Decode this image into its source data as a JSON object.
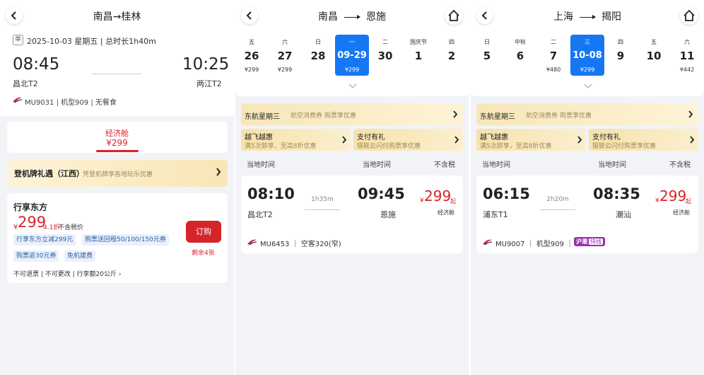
{
  "panel1": {
    "title": "南昌→桂林",
    "tag": "单",
    "date_line": "2025-10-03 星期五 | 总时长1h40m",
    "dep_time": "08:45",
    "arr_time": "10:25",
    "dep_terminal": "昌北T2",
    "arr_terminal": "两江T2",
    "flight_info": "MU9031 | 机型909 | 无餐食",
    "cabin_name": "经济舱",
    "cabin_price": "¥299",
    "board_title": "登机牌礼遇（江西）",
    "board_sub": "凭登机牌享各地玩乐优惠",
    "product": {
      "name": "行享东方",
      "currency": "¥",
      "price": "299",
      "discount": "4.1折",
      "tax_note": "不含税价",
      "chips": [
        "行享东方立减299元",
        "购票送回程50/100/150元券",
        "购票返30元券",
        "免机建费"
      ],
      "rules": "不可退票 | 不可更改 | 行李额20公斤 ›",
      "buy_label": "订购",
      "remaining": "剩余4张"
    }
  },
  "panel2": {
    "origin": "南昌",
    "dest": "恩施",
    "dates": [
      {
        "wd": "五",
        "d": "26",
        "p": "¥299"
      },
      {
        "wd": "六",
        "d": "27",
        "p": "¥299"
      },
      {
        "wd": "日",
        "d": "28",
        "p": ""
      },
      {
        "wd": "一",
        "d": "09-29",
        "p": "¥299"
      },
      {
        "wd": "二",
        "d": "30",
        "p": ""
      },
      {
        "wd": "国庆节",
        "d": "1",
        "p": ""
      },
      {
        "wd": "四",
        "d": "2",
        "p": ""
      }
    ],
    "promo_title": "东航星期三",
    "promo_sub": "航空消费券 购票享优惠",
    "promo_a_title": "越飞越惠",
    "promo_a_sub": "满5次即享，至高8折优惠",
    "promo_b_title": "支付有礼",
    "promo_b_sub": "银联云闪付购票享优惠",
    "col_dep": "当地时间",
    "col_arr": "当地时间",
    "col_tax": "不含税",
    "flight": {
      "dep_time": "08:10",
      "arr_time": "09:45",
      "duration": "1h35m",
      "dep_terminal": "昌北T2",
      "arr_terminal": "恩施",
      "currency": "¥",
      "price": "299",
      "qi": "起",
      "cabin": "经济舱",
      "meta": "MU6453 ｜ 空客320(窄)"
    }
  },
  "panel3": {
    "origin": "上海",
    "dest": "揭阳",
    "dates": [
      {
        "wd": "日",
        "d": "5",
        "p": ""
      },
      {
        "wd": "中秋",
        "d": "6",
        "p": ""
      },
      {
        "wd": "二",
        "d": "7",
        "p": "¥480"
      },
      {
        "wd": "三",
        "d": "10-08",
        "p": "¥299"
      },
      {
        "wd": "四",
        "d": "9",
        "p": ""
      },
      {
        "wd": "五",
        "d": "10",
        "p": ""
      },
      {
        "wd": "六",
        "d": "11",
        "p": "¥442"
      }
    ],
    "promo_title": "东航星期三",
    "promo_sub": "航空消费券 购票享优惠",
    "promo_a_title": "越飞越惠",
    "promo_a_sub": "满5次即享，至高8折优惠",
    "promo_b_title": "支付有礼",
    "promo_b_sub": "银联云闪付购票享优惠",
    "col_dep": "当地时间",
    "col_arr": "当地时间",
    "col_tax": "不含税",
    "flight": {
      "dep_time": "06:15",
      "arr_time": "08:35",
      "duration": "2h20m",
      "dep_terminal": "浦东T1",
      "arr_terminal": "潮汕",
      "currency": "¥",
      "price": "299",
      "qi": "起",
      "cabin": "经济舱",
      "meta": "MU9007 ｜ 机型909 ｜",
      "badge_a": "沪潮",
      "badge_b": "快线"
    }
  },
  "colors": {
    "accent_red": "#d6242b",
    "select_blue": "#1677f3",
    "chip_blue": "#2a5ca8"
  },
  "icons": [
    "back-icon",
    "home-icon",
    "chevron-right-icon",
    "chevron-down-icon",
    "airline-logo-icon"
  ]
}
